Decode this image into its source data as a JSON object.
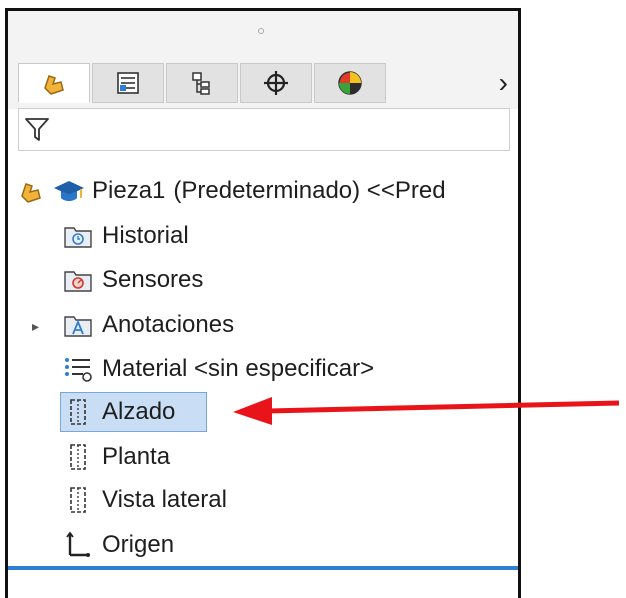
{
  "tabs": [
    {
      "name": "featuremanager",
      "icon": "feature-manager-icon"
    },
    {
      "name": "propertymanager",
      "icon": "property-manager-icon"
    },
    {
      "name": "configurationmanager",
      "icon": "configuration-manager-icon"
    },
    {
      "name": "dimxpertmanager",
      "icon": "dimxpert-icon"
    },
    {
      "name": "displaymanager",
      "icon": "display-manager-icon"
    }
  ],
  "tree": {
    "root": {
      "part": "Pieza1",
      "configuration": "(Predeterminado) <<Pred"
    },
    "items": [
      {
        "label": "Historial",
        "icon": "history-folder-icon"
      },
      {
        "label": "Sensores",
        "icon": "sensors-folder-icon"
      },
      {
        "label": "Anotaciones",
        "icon": "annotations-folder-icon"
      },
      {
        "label": "Material <sin especificar>",
        "icon": "material-icon"
      },
      {
        "label": "Alzado",
        "icon": "plane-icon"
      },
      {
        "label": "Planta",
        "icon": "plane-icon"
      },
      {
        "label": "Vista lateral",
        "icon": "plane-icon"
      },
      {
        "label": "Origen",
        "icon": "origin-icon"
      }
    ],
    "selected": "Alzado"
  },
  "colors": {
    "selection": "#c9def5",
    "arrow": "#e8141a",
    "accent_bar": "#2f7fd0"
  }
}
